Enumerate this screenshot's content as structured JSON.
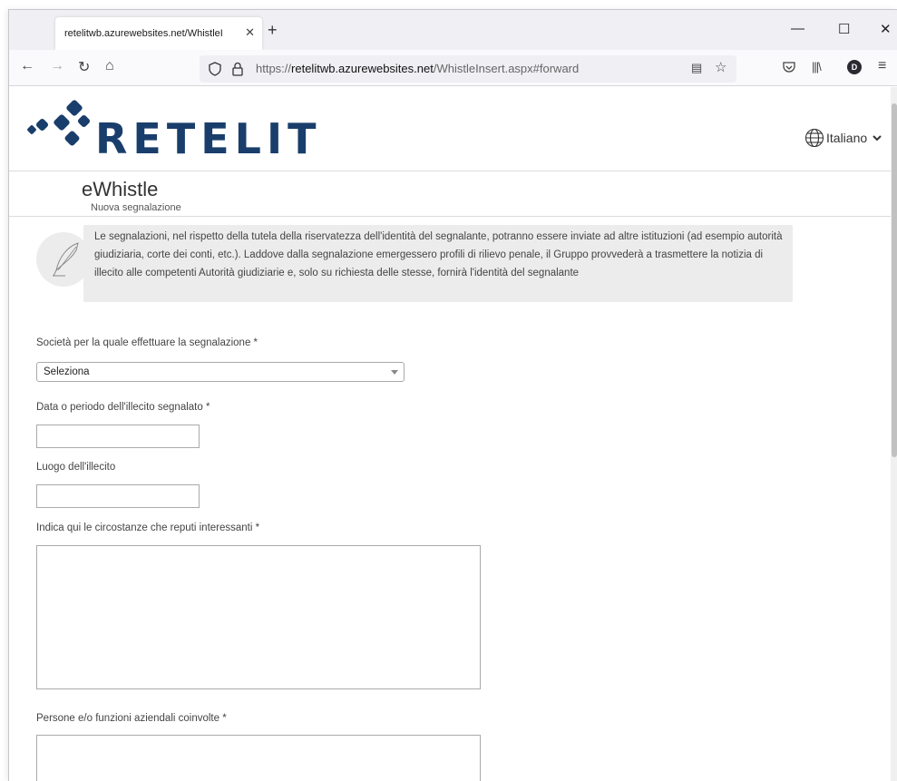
{
  "browser": {
    "tab_title": "retelitwb.azurewebsites.net/WhistleI",
    "url_prefix": "https://",
    "url_domain": "retelitwb.azurewebsites.net",
    "url_path": "/WhistleInsert.aspx#forward",
    "profile_initial": "D"
  },
  "header": {
    "logo_text": "RETELIT",
    "language": "Italiano",
    "app_title": "eWhistle",
    "app_subtitle": "Nuova segnalazione"
  },
  "notice": {
    "text": "Le segnalazioni, nel rispetto della tutela della riservatezza dell'identità del segnalante, potranno essere inviate ad altre istituzioni (ad esempio autorità giudiziaria, corte dei conti, etc.). Laddove dalla segnalazione emergessero profili di rilievo penale, il Gruppo provvederà a trasmettere la notizia di illecito alle competenti Autorità giudiziarie e, solo su richiesta delle stesse, fornirà l'identità del segnalante"
  },
  "form": {
    "company_label": "Società per la quale effettuare la segnalazione *",
    "company_value": "Seleziona",
    "date_label": "Data o periodo dell'illecito segnalato *",
    "place_label": "Luogo dell'illecito",
    "circumstances_label": "Indica qui le circostanze che reputi interessanti *",
    "persons_label": "Persone e/o funzioni aziendali coinvolte *"
  },
  "colors": {
    "logo_blue": "#1a3e6b",
    "notice_bg": "#ececec"
  }
}
